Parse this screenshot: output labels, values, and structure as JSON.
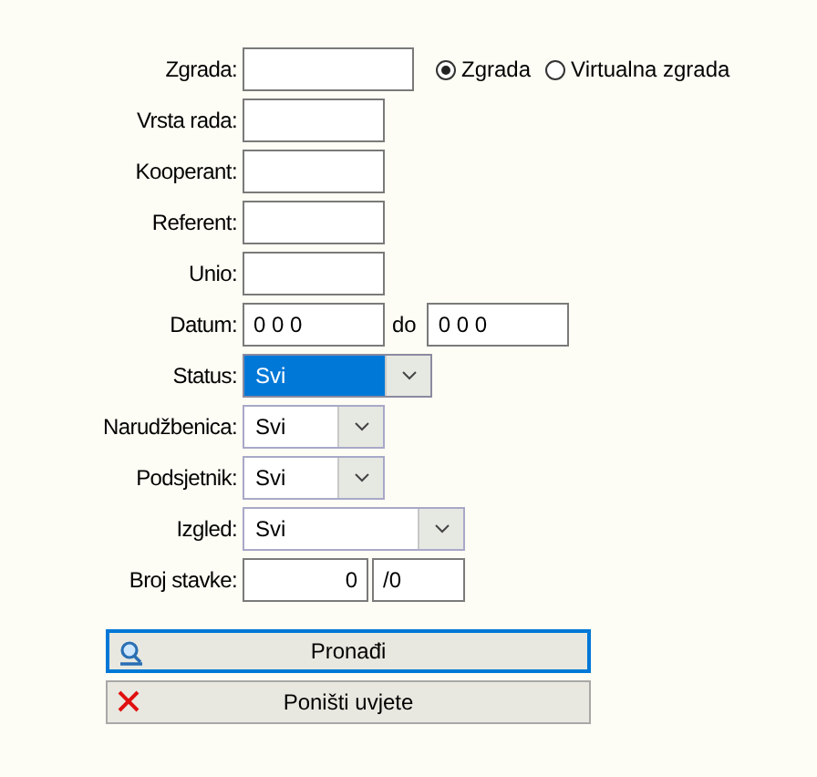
{
  "fields": [
    {
      "kind": "text",
      "label": "Zgrada:",
      "radios": [
        {
          "label": "Zgrada",
          "selected": true
        },
        {
          "label": "Virtualna zgrada",
          "selected": false
        }
      ]
    },
    {
      "kind": "text",
      "label": "Vrsta rada:"
    },
    {
      "kind": "text",
      "label": "Kooperant:"
    },
    {
      "kind": "text",
      "label": "Referent:"
    },
    {
      "kind": "text",
      "label": "Unio:"
    },
    {
      "kind": "range",
      "label": "Datum:",
      "from": "0 0 0",
      "separator": "do",
      "to": "0 0 0"
    },
    {
      "kind": "select",
      "label": "Status:",
      "value": "Svi",
      "focused": true
    },
    {
      "kind": "select",
      "label": "Narudžbenica:",
      "value": "Svi",
      "focused": false
    },
    {
      "kind": "select",
      "label": "Podsjetnik:",
      "value": "Svi",
      "focused": false
    },
    {
      "kind": "select",
      "label": "Izgled:",
      "value": "Svi",
      "focused": false
    },
    {
      "kind": "count",
      "label": "Broj stavke:",
      "value": "0",
      "total": "/0"
    }
  ],
  "buttons": [
    {
      "label": "Pronađi",
      "focused": true
    },
    {
      "label": "Poništi uvjete",
      "focused": false
    }
  ]
}
